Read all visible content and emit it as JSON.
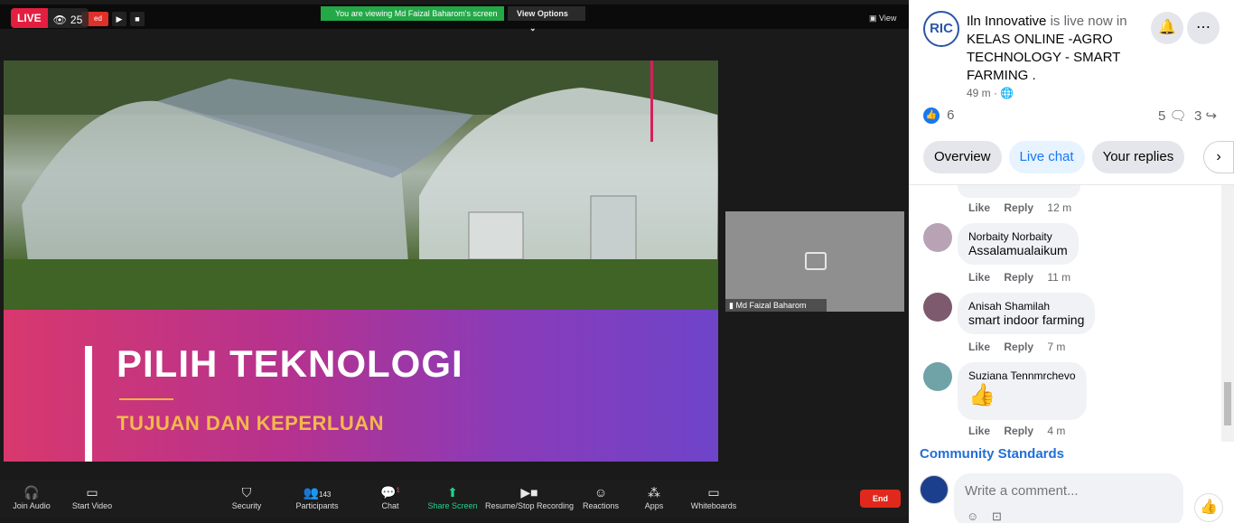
{
  "zoom": {
    "live_label": "LIVE",
    "viewer_count": "25",
    "recording_text": "ed",
    "viewing_banner": "You are viewing Md Faizal Baharom's screen",
    "view_options": "View Options",
    "view_label": "View",
    "thumbnail_name": "Md Faizal Baharom",
    "toolbar": [
      {
        "label": "Join Audio",
        "icon": "headphones-icon"
      },
      {
        "label": "Start Video",
        "icon": "video-off-icon"
      },
      {
        "label": "Security",
        "icon": "shield-icon"
      },
      {
        "label": "Participants",
        "icon": "participants-icon",
        "badge": "143"
      },
      {
        "label": "Chat",
        "icon": "chat-icon",
        "badge": "1"
      },
      {
        "label": "Share Screen",
        "icon": "share-screen-icon"
      },
      {
        "label": "Resume/Stop Recording",
        "icon": "recording-icon"
      },
      {
        "label": "Reactions",
        "icon": "reactions-icon"
      },
      {
        "label": "Apps",
        "icon": "apps-icon"
      },
      {
        "label": "Whiteboards",
        "icon": "whiteboard-icon"
      }
    ],
    "end_label": "End"
  },
  "slide": {
    "title": "PILIH TEKNOLOGI",
    "subtitle": "TUJUAN DAN KEPERLUAN"
  },
  "facebook": {
    "page_name": "Iln Innovative",
    "live_text": "is live now in",
    "group_name": "KELAS ONLINE -AGRO TECHNOLOGY - SMART FARMING .",
    "time_ago": "49 m ·",
    "avatar_text": "RIC",
    "reaction_count": "6",
    "comment_count": "5",
    "share_count": "3",
    "tabs": [
      "Overview",
      "Live chat",
      "Your replies"
    ],
    "comments": [
      {
        "name": "Norbaity Norbaity",
        "text": "Assalamualaikum",
        "time": "11 m"
      },
      {
        "name": "Anisah Shamilah",
        "text": "smart indoor farming",
        "time": "7 m"
      },
      {
        "name": "Suziana Tennmrchevo",
        "text": "👍",
        "time": "4 m"
      }
    ],
    "prev_comment_time": "12 m",
    "like_label": "Like",
    "reply_label": "Reply",
    "community_standards": "Community Standards",
    "comment_placeholder": "Write a comment..."
  }
}
